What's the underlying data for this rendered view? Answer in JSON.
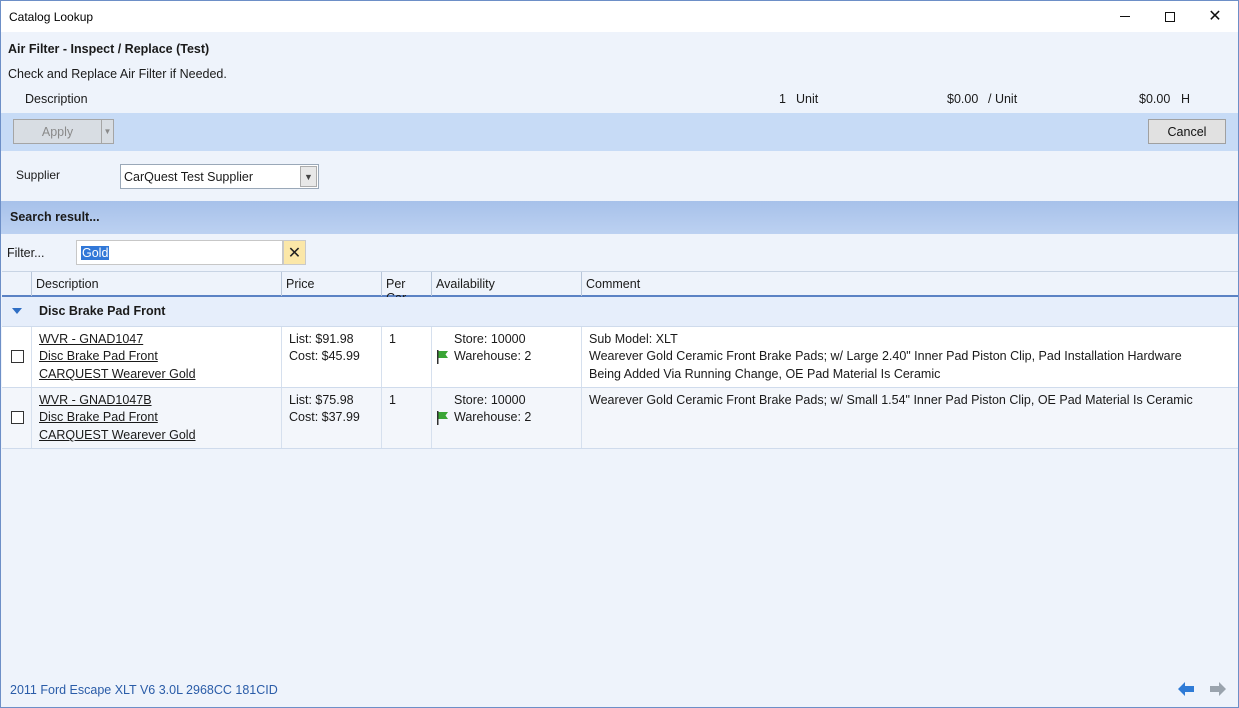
{
  "window": {
    "title": "Catalog Lookup"
  },
  "service": {
    "title": "Air Filter - Inspect / Replace (Test)",
    "description": "Check and Replace Air Filter if Needed.",
    "line": {
      "label": "Description",
      "qty": "1",
      "qty_unit": "Unit",
      "price": "$0.00",
      "price_unit": "/ Unit",
      "total": "$0.00",
      "total_suffix": "H"
    }
  },
  "toolbar": {
    "apply_label": "Apply",
    "cancel_label": "Cancel"
  },
  "supplier": {
    "label": "Supplier",
    "value": "CarQuest Test Supplier"
  },
  "search": {
    "header": "Search result...",
    "filter_label": "Filter...",
    "filter_value": "Gold"
  },
  "grid": {
    "columns": [
      "Description",
      "Price",
      "Per Car",
      "Availability",
      "Comment"
    ],
    "group": "Disc Brake Pad Front",
    "rows": [
      {
        "part": "WVR - GNAD1047",
        "name": "Disc Brake Pad Front",
        "brand": "CARQUEST Wearever Gold",
        "list": "List: $91.98",
        "cost": "Cost: $45.99",
        "per_car": "1",
        "store": "Store: 10000",
        "warehouse": "Warehouse: 2",
        "comment1": "Sub Model: XLT",
        "comment2": "Wearever Gold Ceramic Front Brake Pads; w/ Large 2.40\" Inner Pad Piston Clip, Pad Installation Hardware",
        "comment3": "Being Added Via Running Change, OE Pad Material Is Ceramic"
      },
      {
        "part": "WVR - GNAD1047B",
        "name": "Disc Brake Pad Front",
        "brand": "CARQUEST Wearever Gold",
        "list": "List: $75.98",
        "cost": "Cost: $37.99",
        "per_car": "1",
        "store": "Store: 10000",
        "warehouse": "Warehouse: 2",
        "comment1": "Wearever Gold Ceramic Front Brake Pads; w/ Small 1.54\" Inner Pad Piston Clip, OE Pad Material Is Ceramic"
      }
    ]
  },
  "footer": {
    "vehicle": "2011 Ford Escape XLT V6 3.0L 2968CC 181CID"
  },
  "icons": {
    "availability": "green-flag-icon",
    "prev": "arrow-left-icon",
    "next": "arrow-right-icon",
    "clear": "clear-x-icon"
  },
  "colors": {
    "accent": "#2f6ec4",
    "toolbar": "#c7dbf6",
    "flag": "#3aa535",
    "nav_active": "#2f7bd6",
    "nav_disabled": "#9aa3ad"
  }
}
